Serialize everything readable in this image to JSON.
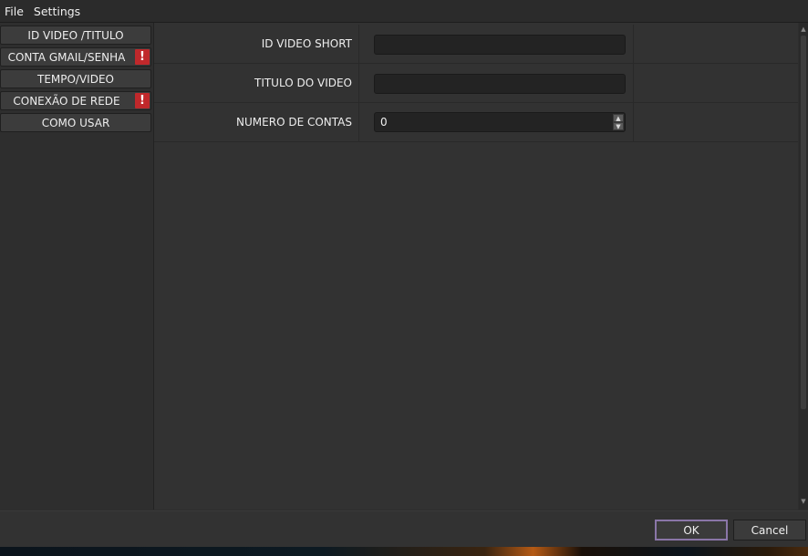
{
  "menu": {
    "file": "File",
    "settings": "Settings"
  },
  "sidebar": {
    "items": [
      {
        "label": "ID VIDEO /TITULO",
        "warning": false
      },
      {
        "label": "CONTA GMAIL/SENHA",
        "warning": true
      },
      {
        "label": "TEMPO/VIDEO",
        "warning": false
      },
      {
        "label": "CONEXÃO DE REDE",
        "warning": true
      },
      {
        "label": "COMO USAR",
        "warning": false
      }
    ],
    "warning_glyph": "!"
  },
  "form": {
    "fields": [
      {
        "label": "ID VIDEO SHORT",
        "value": ""
      },
      {
        "label": "TITULO DO VIDEO",
        "value": ""
      },
      {
        "label": "NUMERO DE CONTAS",
        "value": "0"
      }
    ]
  },
  "footer": {
    "ok_label": "OK",
    "cancel_label": "Cancel"
  },
  "colors": {
    "warning": "#c0282b",
    "ok_border": "#8a76a8",
    "background": "#323232"
  },
  "icons": [
    "warning-icon",
    "spin-up-icon",
    "spin-down-icon"
  ]
}
